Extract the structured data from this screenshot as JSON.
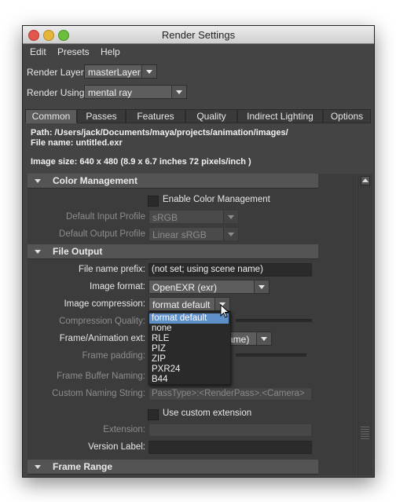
{
  "window": {
    "title": "Render Settings"
  },
  "menubar": {
    "items": [
      "Edit",
      "Presets",
      "Help"
    ]
  },
  "render_layer": {
    "label": "Render Layer",
    "value": "masterLayer"
  },
  "render_using": {
    "label": "Render Using",
    "value": "mental ray"
  },
  "tabs": [
    "Common",
    "Passes",
    "Features",
    "Quality",
    "Indirect Lighting",
    "Options"
  ],
  "active_tab": "Common",
  "info": {
    "path": "Path: /Users/jack/Documents/maya/projects/animation/images/",
    "file_name": "File name:  untitled.exr",
    "image_size": "Image size: 640 x 480 (8.9 x 6.7 inches 72 pixels/inch )"
  },
  "color_management": {
    "title": "Color Management",
    "enable_label": "Enable Color Management",
    "input_profile_label": "Default Input Profile",
    "input_profile_value": "sRGB",
    "output_profile_label": "Default Output Profile",
    "output_profile_value": "Linear sRGB"
  },
  "file_output": {
    "title": "File Output",
    "prefix_label": "File name prefix:",
    "prefix_value": "(not set; using scene name)",
    "format_label": "Image format:",
    "format_value": "OpenEXR (exr)",
    "compression_label": "Image compression:",
    "compression_value": "format default",
    "compression_quality_label": "Compression Quality:",
    "frame_ext_label": "Frame/Animation ext:",
    "frame_ext_value_tail": "ame)",
    "frame_padding_label": "Frame padding:",
    "frame_buffer_label": "Frame Buffer Naming:",
    "custom_naming_label": "Custom Naming String:",
    "custom_naming_value": "PassType>:<RenderPass>.<Camera>",
    "use_custom_ext_label": "Use custom extension",
    "extension_label": "Extension:",
    "version_label": "Version Label:"
  },
  "compression_dropdown": {
    "options": [
      "format default",
      "none",
      "RLE",
      "PIZ",
      "ZIP",
      "PXR24",
      "B44"
    ],
    "selected": "format default"
  },
  "frame_range": {
    "title": "Frame Range"
  }
}
